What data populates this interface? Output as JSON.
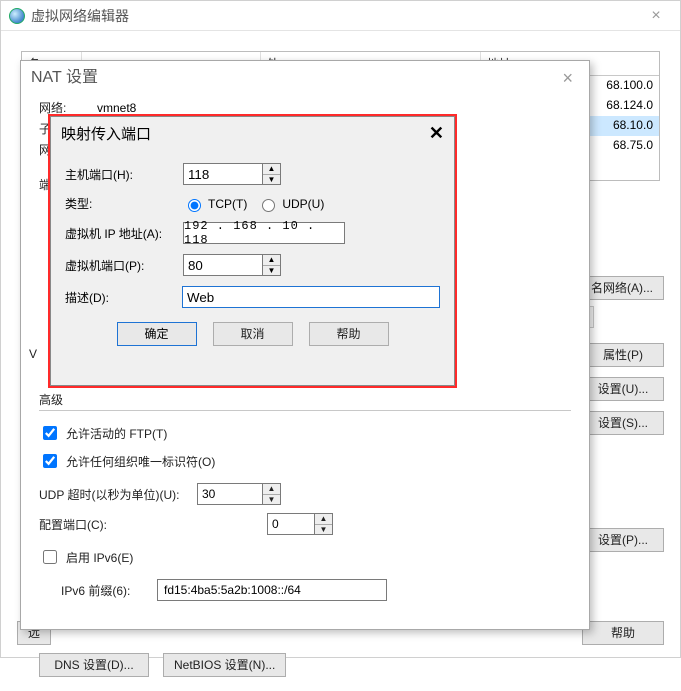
{
  "main_window": {
    "title": "虚拟网络编辑器",
    "close_glyph": "×",
    "header_name": "名",
    "header_ext": "外",
    "header_addr": "地址",
    "rows": [
      {
        "addr": "68.100.0"
      },
      {
        "addr": "68.124.0"
      },
      {
        "addr": "68.10.0",
        "selected": true
      },
      {
        "addr": "68.75.0"
      }
    ],
    "rename_btn": "名网络(A)...",
    "props_btn": "属性(P)",
    "set_u_btn": "设置(U)...",
    "set_s_btn": "设置(S)...",
    "set_p_btn": "设置(P)...",
    "scroll_left": "<",
    "scroll_right": ">",
    "help_btn": "帮助",
    "trunc_btn": "远"
  },
  "nat": {
    "title": "NAT 设置",
    "close_glyph": "×",
    "network_label": "网络:",
    "network_value": "vmnet8",
    "subnet_label": "子",
    "gw_label": "网",
    "port_section": "端",
    "advanced": "高级",
    "ftp_chk": "允许活动的 FTP(T)",
    "org_chk": "允许任何组织唯一标识符(O)",
    "udp_label": "UDP 超时(以秒为单位)(U):",
    "udp_value": "30",
    "cfg_port_label": "配置端口(C):",
    "cfg_port_value": "0",
    "ipv6_chk": "启用 IPv6(E)",
    "ipv6_prefix_label": "IPv6 前缀(6):",
    "ipv6_prefix_value": "fd15:4ba5:5a2b:1008::/64",
    "dns_btn": "DNS 设置(D)...",
    "netbios_btn": "NetBIOS 设置(N)..."
  },
  "port": {
    "title": "映射传入端口",
    "close_glyph": "✕",
    "host_port_label": "主机端口(H):",
    "host_port_value": "118",
    "type_label": "类型:",
    "tcp_label": "TCP(T)",
    "udp_label": "UDP(U)",
    "vm_ip_label": "虚拟机 IP 地址(A):",
    "vm_ip_value": "192 . 168 .  10  . 118",
    "vm_port_label": "虚拟机端口(P):",
    "vm_port_value": "80",
    "desc_label": "描述(D):",
    "desc_value": "Web",
    "ok_btn": "确定",
    "cancel_btn": "取消",
    "help_btn": "帮助"
  }
}
